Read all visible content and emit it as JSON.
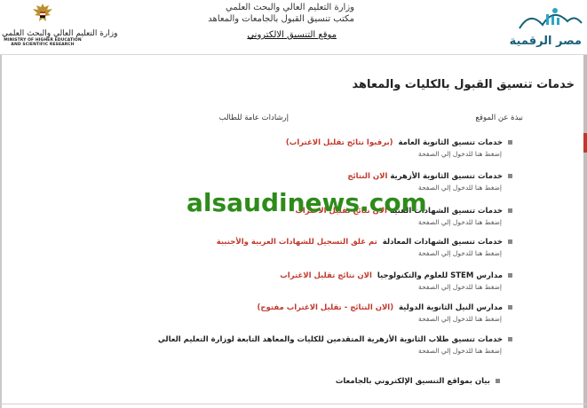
{
  "header": {
    "ministry_ar": "وزارة التعليم العالي والبحث العلمي",
    "ministry_en_1": "MINISTRY OF HIGHER EDUCATION",
    "ministry_en_2": "AND SCIENTIFIC RESEARCH",
    "center_line1": "وزارة التعليم العالي والبحث العلمي",
    "center_line2": "مكتب تنسيق القبول بالجامعات والمعاهد",
    "center_site": "موقع التنسيق الالكتروني",
    "right_logo_text": "مصر الرقمية"
  },
  "page": {
    "title": "خدمات تنسيق القبول بالكليات والمعاهد",
    "col_right": "نبذة عن الموقع",
    "col_left": "إرشادات عامة للطالب"
  },
  "services": [
    {
      "title": "خدمات تنسيق الثانوية العامة",
      "highlight": "(برقبوا نتائج تقليل الاغتراب)",
      "sub": "إضغط هنا للدخول إلي الصفحة"
    },
    {
      "title": "خدمات تنسيق الثانوية الأزهرية",
      "highlight": "الان النتائج",
      "sub": "إضغط هنا للدخول إلي الصفحة"
    },
    {
      "title": "خدمات تنسيق الشهادات الفنية",
      "highlight": "الان نتائج تقليل الاغتراب",
      "sub": "إضغط هنا للدخول إلي الصفحة"
    },
    {
      "title": "خدمات تنسيق الشهادات المعادلة",
      "highlight": "تم غلق التسجيل للشهادات العربية والأجنبية",
      "sub": "إضغط هنا للدخول إلي الصفحة"
    },
    {
      "title": "مدارس STEM للعلوم والتكنولوجيا",
      "highlight": "الان نتائج تقليل الاغتراب",
      "sub": "إضغط هنا للدخول إلي الصفحة"
    },
    {
      "title": "مدارس النيل الثانوية الدولية",
      "highlight": "(الان النتائج - تقليل الاغتراب مفتوح)",
      "sub": "إضغط هنا للدخول إلي الصفحة"
    },
    {
      "title": "خدمات تنسيق طلاب الثانوية الأزهرية المتقدمين للكليات والمعاهد التابعة لوزارة التعليم العالي",
      "highlight": "",
      "sub": "إضغط هنا للدخول إلي الصفحة"
    }
  ],
  "footer": {
    "link": "بيان بمواقع التنسيق الإلكتروني بالجامعات"
  },
  "watermark": "alsaudinews.com",
  "colors": {
    "highlight": "#c0392b",
    "watermark": "#2e8b1a",
    "logo_blue": "#17607b"
  }
}
